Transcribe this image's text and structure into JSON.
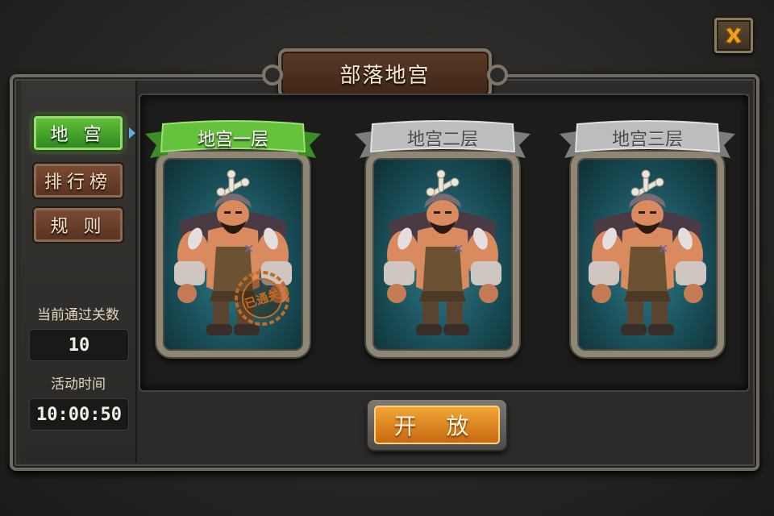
{
  "title": "部落地宫",
  "sidebar": {
    "items": [
      {
        "label": "地 宫",
        "active": true
      },
      {
        "label": "排行榜",
        "active": false
      },
      {
        "label": "规 则",
        "active": false
      }
    ],
    "passed_label": "当前通过关数",
    "passed_value": "10",
    "time_label": "活动时间",
    "time_value": "10:00:50"
  },
  "floors": [
    {
      "name": "地宫一层",
      "state": "selected",
      "cleared": true,
      "stamp": "已通关"
    },
    {
      "name": "地宫二层",
      "state": "normal",
      "cleared": false
    },
    {
      "name": "地宫三层",
      "state": "normal",
      "cleared": false
    }
  ],
  "open_button": "开 放",
  "icons": {
    "close": "close-icon",
    "boss": "barbarian-boss-portrait"
  },
  "colors": {
    "active_green": "#4aa82e",
    "banner_gray": "#bdbdbd",
    "open_orange": "#e08a22",
    "stamp_brown": "#c26a20"
  }
}
